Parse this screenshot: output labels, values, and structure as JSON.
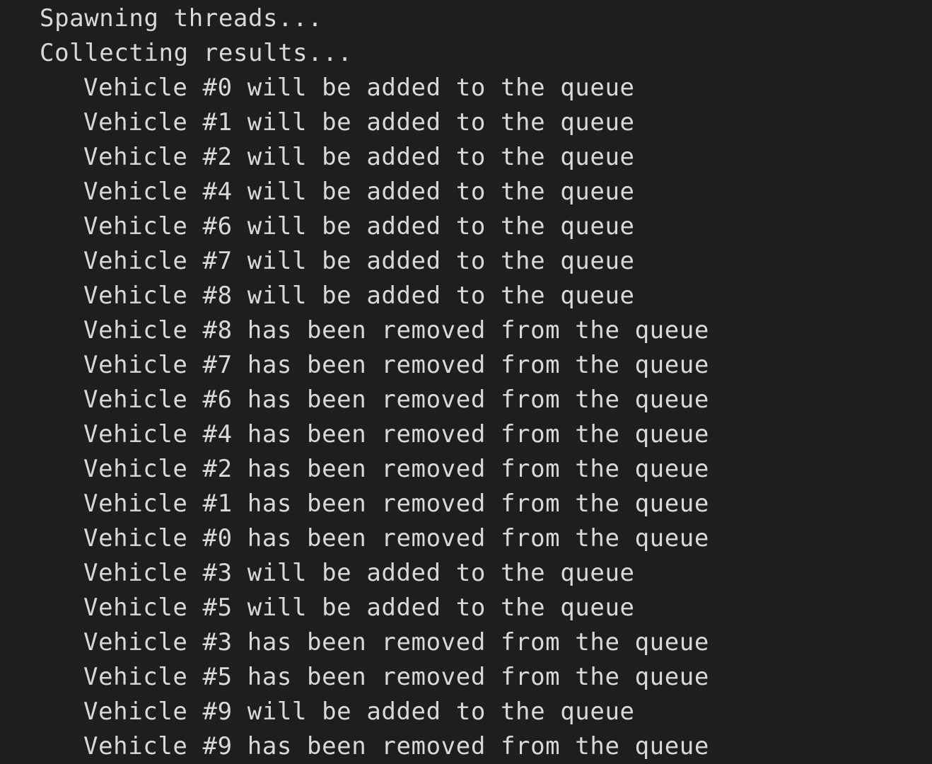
{
  "terminal": {
    "header_lines": [
      "Spawning threads...",
      "Collecting results..."
    ],
    "log_lines": [
      "Vehicle #0 will be added to the queue",
      "Vehicle #1 will be added to the queue",
      "Vehicle #2 will be added to the queue",
      "Vehicle #4 will be added to the queue",
      "Vehicle #6 will be added to the queue",
      "Vehicle #7 will be added to the queue",
      "Vehicle #8 will be added to the queue",
      "Vehicle #8 has been removed from the queue",
      "Vehicle #7 has been removed from the queue",
      "Vehicle #6 has been removed from the queue",
      "Vehicle #4 has been removed from the queue",
      "Vehicle #2 has been removed from the queue",
      "Vehicle #1 has been removed from the queue",
      "Vehicle #0 has been removed from the queue",
      "Vehicle #3 will be added to the queue",
      "Vehicle #5 will be added to the queue",
      "Vehicle #3 has been removed from the queue",
      "Vehicle #5 has been removed from the queue",
      "Vehicle #9 will be added to the queue",
      "Vehicle #9 has been removed from the queue"
    ],
    "colors": {
      "background": "#1e1e1e",
      "text": "#d9d9d9"
    }
  }
}
